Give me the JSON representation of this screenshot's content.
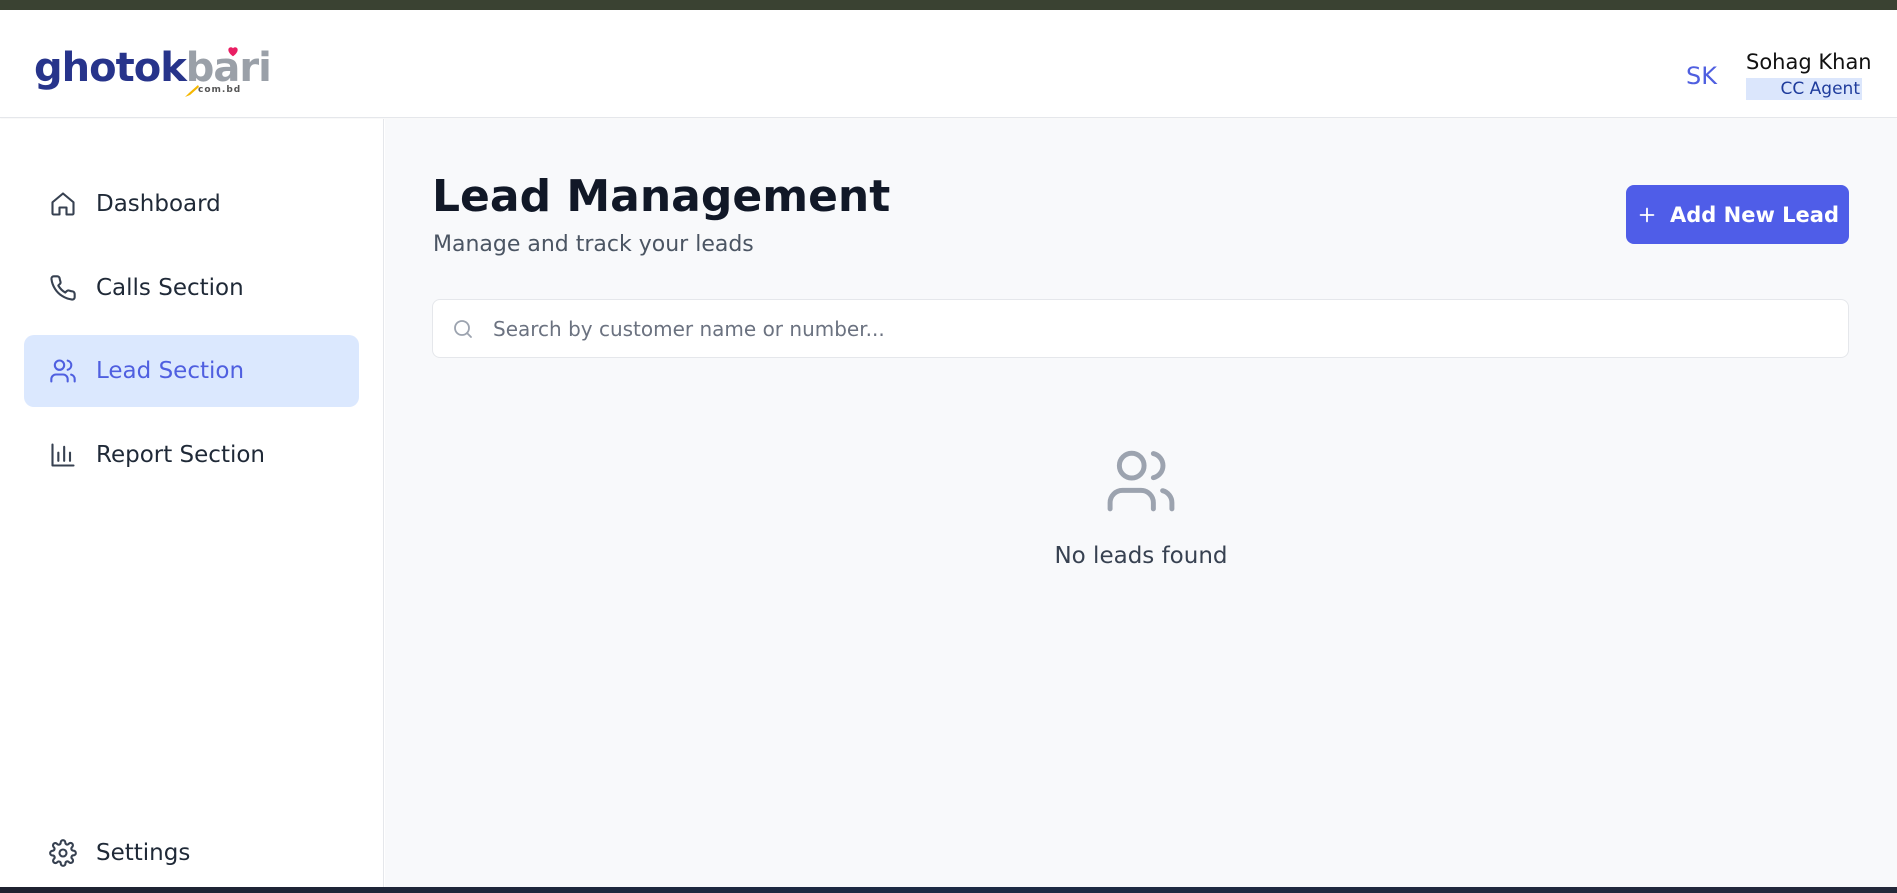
{
  "header": {
    "logo": {
      "brand_primary": "ghotok",
      "brand_secondary": "bari",
      "domain_suffix": "com.bd"
    },
    "user": {
      "initials": "SK",
      "name": "Sohag Khan",
      "role": "CC Agent"
    }
  },
  "sidebar": {
    "items": [
      {
        "label": "Dashboard",
        "icon": "home-icon",
        "active": false
      },
      {
        "label": "Calls Section",
        "icon": "phone-icon",
        "active": false
      },
      {
        "label": "Lead Section",
        "icon": "users-icon",
        "active": true
      },
      {
        "label": "Report Section",
        "icon": "bar-chart-icon",
        "active": false
      }
    ],
    "settings": {
      "label": "Settings",
      "icon": "gear-icon"
    }
  },
  "main": {
    "title": "Lead Management",
    "subtitle": "Manage and track your leads",
    "add_button_label": "Add New Lead",
    "search": {
      "placeholder": "Search by customer name or number...",
      "value": ""
    },
    "empty_state": {
      "message": "No leads found",
      "icon": "users-icon"
    }
  },
  "colors": {
    "accent": "#4f5de8",
    "active_nav_bg": "#dbe8fe",
    "brand_navy": "#27348b",
    "heart": "#e91e63"
  }
}
